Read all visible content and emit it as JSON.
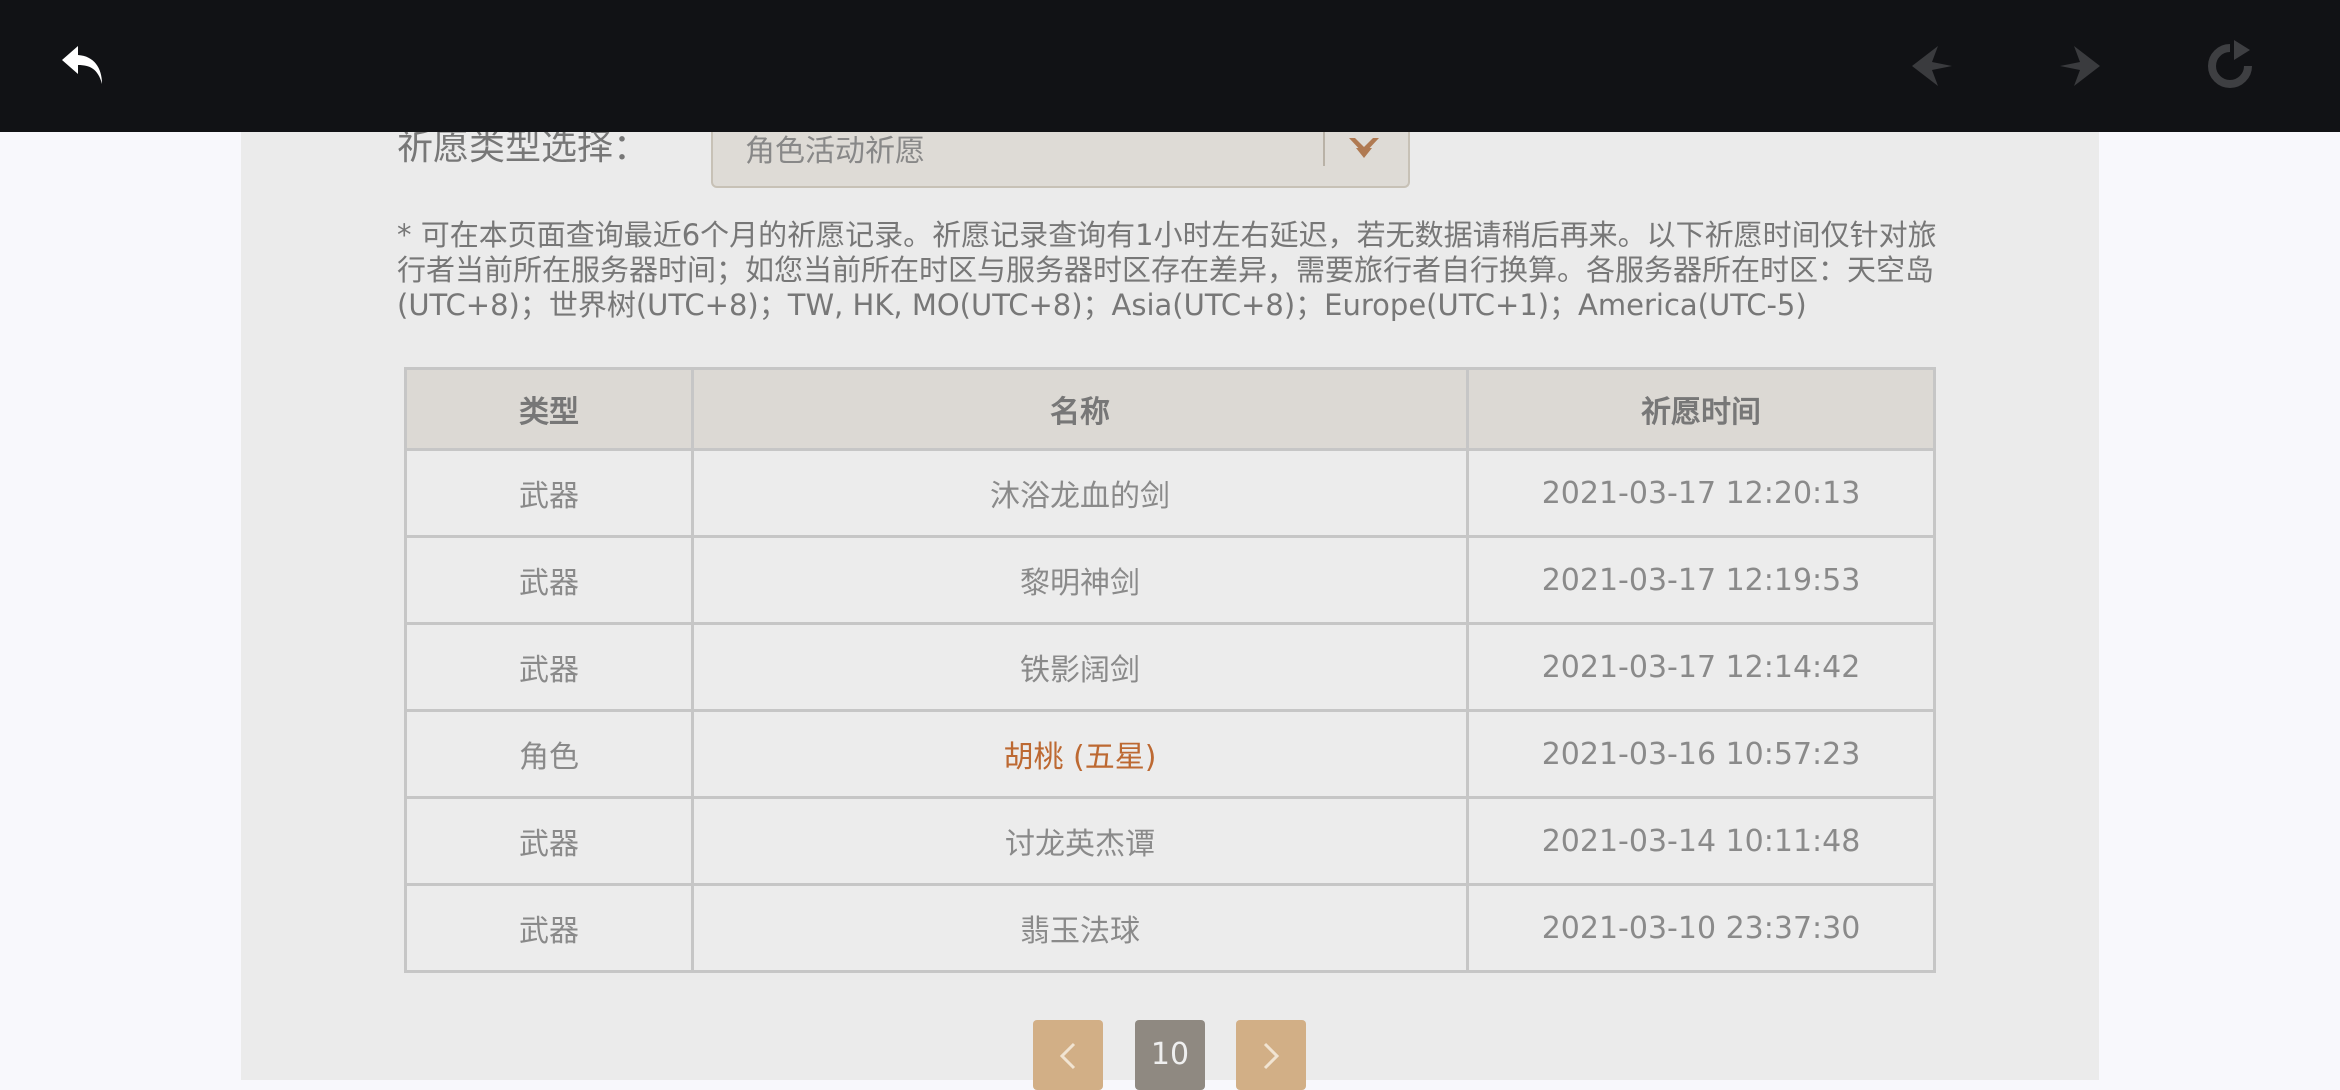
{
  "toolbar": {
    "back_icon": "back-arrow-icon",
    "nav_prev_icon": "nav-back-icon",
    "nav_forward_icon": "nav-forward-icon",
    "refresh_icon": "refresh-icon"
  },
  "filter": {
    "label": "祈愿类型选择：",
    "selected": "角色活动祈愿"
  },
  "notice": "* 可在本页面查询最近6个月的祈愿记录。祈愿记录查询有1小时左右延迟，若无数据请稍后再来。以下祈愿时间仅针对旅行者当前所在服务器时间；如您当前所在时区与服务器时区存在差异，需要旅行者自行换算。各服务器所在时区：天空岛(UTC+8)；世界树(UTC+8)；TW, HK, MO(UTC+8)；Asia(UTC+8)；Europe(UTC+1)；America(UTC-5)",
  "table": {
    "headers": [
      "类型",
      "名称",
      "祈愿时间"
    ],
    "rows": [
      {
        "type": "武器",
        "name": "沐浴龙血的剑",
        "time": "2021-03-17 12:20:13"
      },
      {
        "type": "武器",
        "name": "黎明神剑",
        "time": "2021-03-17 12:19:53"
      },
      {
        "type": "武器",
        "name": "铁影阔剑",
        "time": "2021-03-17 12:14:42"
      },
      {
        "type": "角色",
        "name": "胡桃 (五星)",
        "time": "2021-03-16 10:57:23"
      },
      {
        "type": "武器",
        "name": "讨龙英杰谭",
        "time": "2021-03-14 10:11:48"
      },
      {
        "type": "武器",
        "name": "翡玉法球",
        "time": "2021-03-10 23:37:30"
      }
    ]
  },
  "pagination": {
    "current_page": "10"
  },
  "colors": {
    "toolbar_bg": "#111215",
    "accent_gold": "#d2af86",
    "five_star": "#bd6932"
  }
}
